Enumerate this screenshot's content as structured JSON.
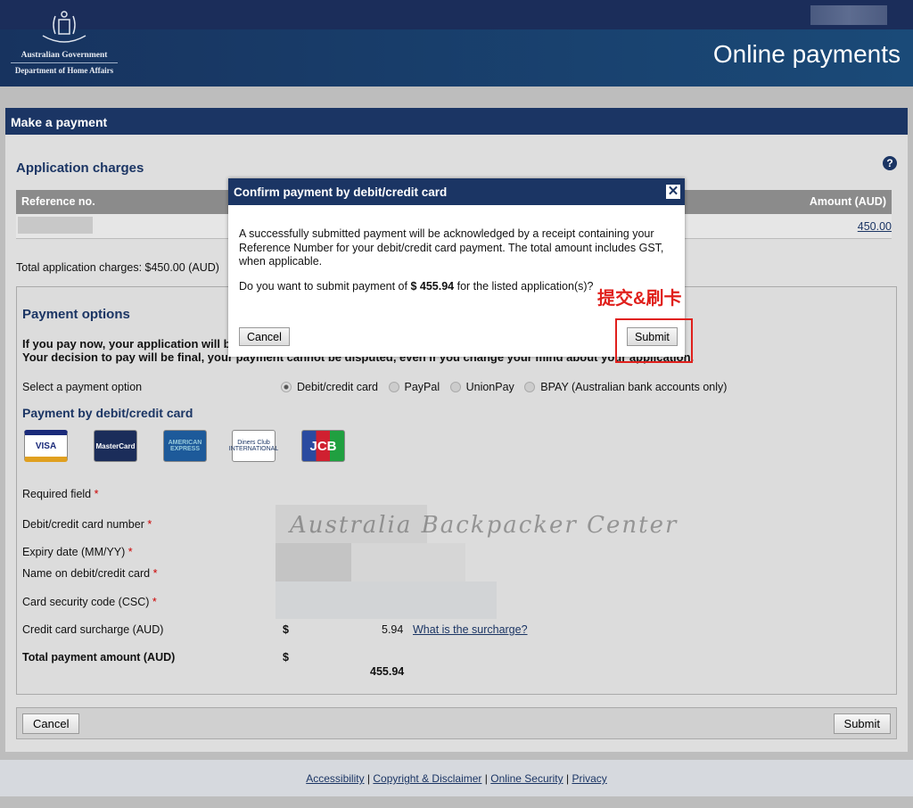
{
  "header": {
    "logo_line1": "Australian Government",
    "logo_line2": "Department of Home Affairs",
    "title": "Online payments"
  },
  "panel": {
    "title": "Make a payment"
  },
  "charges": {
    "title": "Application charges",
    "col_ref": "Reference no.",
    "col_amount": "Amount (AUD)",
    "row_amount": "450.00",
    "total_label": "Total application charges: $450.00 (AUD)"
  },
  "options": {
    "title": "Payment options",
    "warning_line1": "If you pay now, your application will b",
    "warning_line2": "Your decision to pay will be final, your payment cannot be disputed, even if you change your mind about your application.",
    "select_label": "Select a payment option",
    "choices": [
      {
        "label": "Debit/credit card",
        "selected": true
      },
      {
        "label": "PayPal",
        "selected": false
      },
      {
        "label": "UnionPay",
        "selected": false
      },
      {
        "label": "BPAY (Australian bank accounts only)",
        "selected": false
      }
    ]
  },
  "card": {
    "title": "Payment by debit/credit card",
    "logos": [
      "VISA",
      "MasterCard",
      "AMERICAN EXPRESS",
      "Diners Club INTERNATIONAL",
      "JCB"
    ],
    "required": "Required field",
    "number": "Debit/credit card number",
    "expiry": "Expiry date (MM/YY)",
    "name": "Name on debit/credit card",
    "csc": "Card security code (CSC)",
    "surcharge_label": "Credit card surcharge (AUD)",
    "currency": "$",
    "surcharge": "5.94",
    "surcharge_link": "What is the surcharge?",
    "total_label": "Total payment amount (AUD)",
    "total": "455.94",
    "asterisk": "*"
  },
  "buttons": {
    "cancel": "Cancel",
    "submit": "Submit"
  },
  "footer": {
    "links": [
      "Accessibility",
      "Copyright & Disclaimer",
      "Online Security",
      "Privacy"
    ],
    "sep": "|"
  },
  "modal": {
    "title": "Confirm payment by debit/credit card",
    "close": "✕",
    "text": "A successfully submitted payment will be acknowledged by a receipt containing your Reference Number for your debit/credit card payment. The total amount includes GST, when applicable.",
    "question_pre": "Do you want to submit payment of ",
    "question_amount": "$ 455.94",
    "question_post": " for the listed application(s)?",
    "cancel": "Cancel",
    "submit": "Submit"
  },
  "annotation": {
    "text": "提交&刷卡",
    "color": "#e0201c"
  },
  "watermark": "Australia Backpacker Center"
}
